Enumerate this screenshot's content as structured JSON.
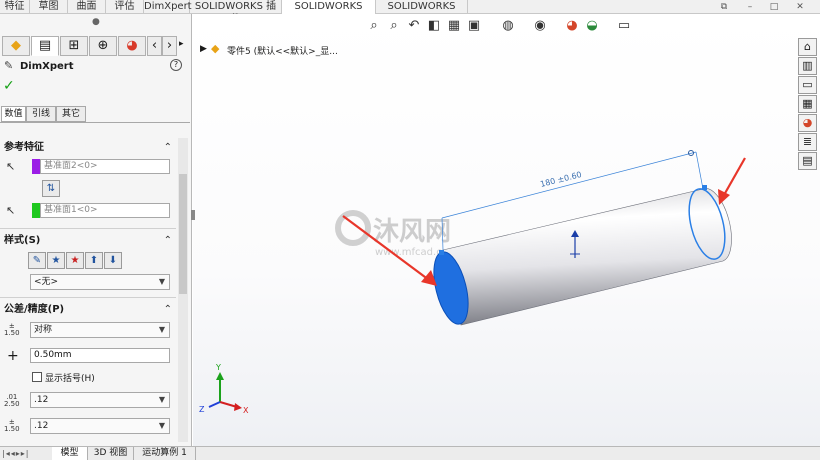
{
  "command_tabs": [
    "特征",
    "草图",
    "曲面",
    "评估",
    "DimXpert",
    "SOLIDWORKS 插件",
    "SOLIDWORKS MBD",
    "SOLIDWORKS CAM"
  ],
  "active_command_tab": "SOLIDWORKS MBD",
  "window_controls": [
    "restore-icon",
    "minimize-icon",
    "maximize-icon",
    "close-icon"
  ],
  "panel": {
    "title": "DimXpert",
    "help_label": "?",
    "tabs": [
      "数值",
      "引线",
      "其它"
    ],
    "reference_section": {
      "title": "参考特征",
      "field1": "基准面2<0>",
      "field1_color": "#9b1de6",
      "field2": "基准面1<0>",
      "field2_color": "#1ec81e"
    },
    "style_section": {
      "title": "样式(S)",
      "value": "<无>"
    },
    "tolerance_section": {
      "title": "公差/精度(P)",
      "tolerance_type": "对称",
      "tolerance_value": "0.50mm",
      "show_parentheses_label": "显示括号(H)",
      "precision1": ".12",
      "precision2": ".12"
    }
  },
  "bottom_tabs": [
    "模型",
    "3D 视图",
    "运动算例 1"
  ],
  "tree": {
    "part_name": "零件5 (默认<<默认>_显..."
  },
  "dimension": {
    "text": "180 ±0.60"
  },
  "watermark": {
    "main": "沐风网",
    "url": "www.mfcad.com"
  },
  "triad": {
    "x": "X",
    "y": "Y",
    "z": "Z"
  },
  "colors": {
    "accent": "#1a66d8",
    "arrow": "#e8362a",
    "face": "#1f6fe0"
  }
}
